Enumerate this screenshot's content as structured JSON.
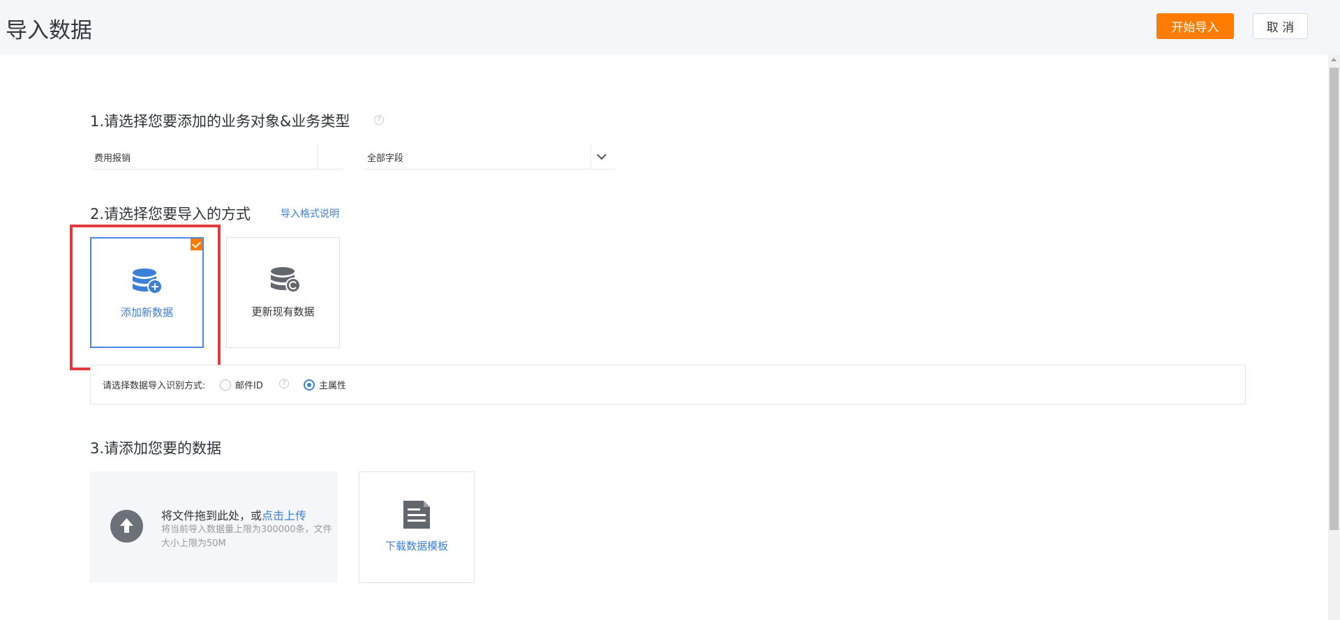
{
  "header": {
    "title": "导入数据",
    "start_import_label": "开始导入",
    "cancel_label": "取 消"
  },
  "step1": {
    "title": "1.请选择您要添加的业务对象&业务类型",
    "help_glyph": "?",
    "object_select": {
      "value": "费用报销"
    },
    "type_select": {
      "value": "全部字段"
    }
  },
  "step2": {
    "title": "2.请选择您要导入的方式",
    "format_help_link": "导入格式说明",
    "methods": [
      {
        "label": "添加新数据",
        "selected": true,
        "icon": "database-add-icon"
      },
      {
        "label": "更新现有数据",
        "selected": false,
        "icon": "database-refresh-icon"
      }
    ],
    "identify": {
      "label": "请选择数据导入识别方式:",
      "options": [
        {
          "label": "邮件ID",
          "checked": false
        },
        {
          "label": "主属性",
          "checked": true
        }
      ],
      "help_glyph": "?"
    }
  },
  "step3": {
    "title": "3.请添加您要的数据",
    "upload": {
      "text": "将文件拖到此处，或",
      "link": "点击上传",
      "hint": "将当前导入数据量上限为300000条，文件大小上限为50M"
    },
    "template": {
      "label": "下载数据模板",
      "icon": "document-icon"
    }
  },
  "colors": {
    "accent_orange": "#ff7c00",
    "link_blue": "#3b7fd8",
    "highlight_red": "#e03a3e",
    "header_bg": "#f5f6f9"
  }
}
